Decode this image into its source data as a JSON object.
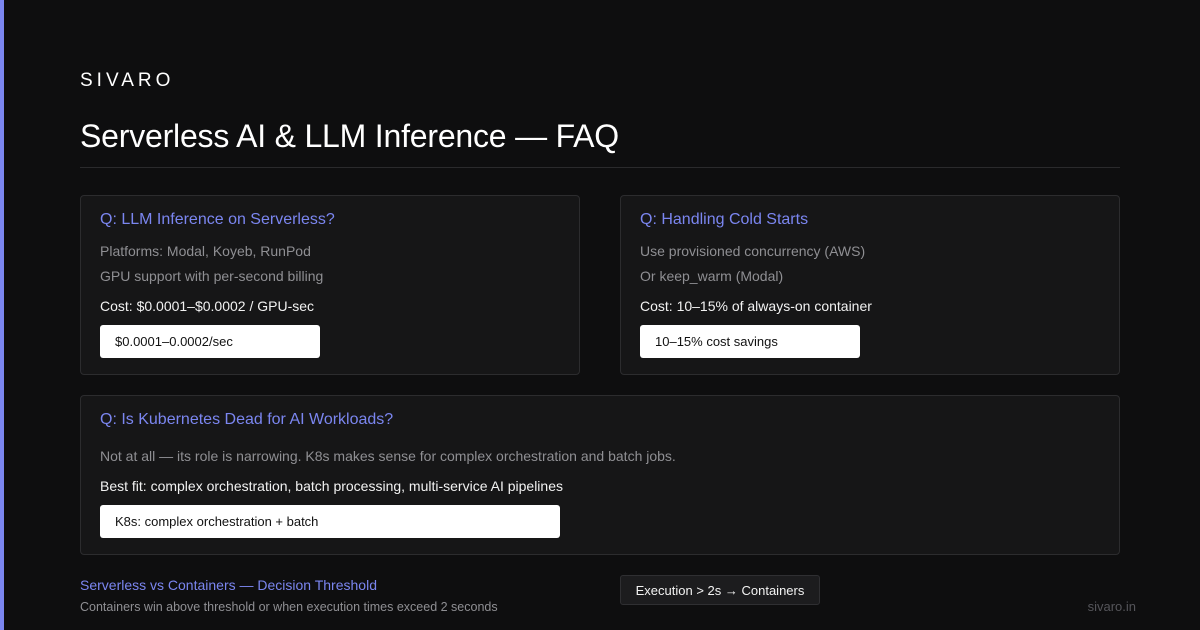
{
  "brand": "SIVARO",
  "title": "Serverless AI & LLM Inference — FAQ",
  "colors": {
    "accent": "#7b86f0",
    "background": "#0e0e0f",
    "card": "#161617",
    "muted_text": "#8f8f93"
  },
  "faq": [
    {
      "question": "Q: LLM Inference on Serverless?",
      "lines": [
        "Platforms: Modal, Koyeb, RunPod",
        "GPU support with per-second billing"
      ],
      "cost": "Cost: $0.0001–$0.0002 / GPU-sec",
      "pill": "$0.0001–0.0002/sec"
    },
    {
      "question": "Q: Handling Cold Starts",
      "lines": [
        "Use provisioned concurrency (AWS)",
        "Or keep_warm (Modal)"
      ],
      "cost": "Cost: 10–15% of always-on container",
      "pill": "10–15% cost savings"
    },
    {
      "question": "Q: Is Kubernetes Dead for AI Workloads?",
      "lines": [
        "Not at all — its role is narrowing. K8s makes sense for complex orchestration and batch jobs."
      ],
      "cost": "Best fit: complex orchestration, batch processing, multi-service AI pipelines",
      "pill": "K8s: complex orchestration + batch"
    }
  ],
  "footer": {
    "title": "Serverless vs Containers — Decision Threshold",
    "subtitle": "Containers win above threshold or when execution times exceed 2 seconds",
    "chip": "Execution > 2s → Containers",
    "site": "sivaro.in"
  }
}
